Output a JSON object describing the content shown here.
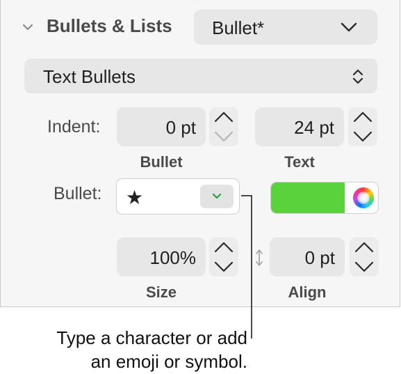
{
  "section": {
    "title": "Bullets & Lists",
    "style_popup": "Bullet*"
  },
  "bullet_type_popup": "Text Bullets",
  "indent": {
    "label": "Indent:",
    "bullet_value": "0 pt",
    "bullet_sublabel": "Bullet",
    "text_value": "24 pt",
    "text_sublabel": "Text"
  },
  "bullet_row": {
    "label": "Bullet:",
    "character": "★",
    "color": "#5ad23c"
  },
  "size_align": {
    "size_value": "100%",
    "size_sublabel": "Size",
    "align_value": "0 pt",
    "align_sublabel": "Align"
  },
  "callout": {
    "line1": "Type a character or add",
    "line2": "an emoji or symbol."
  },
  "icons": [
    "disclosure-chevron-icon",
    "chevron-down-icon",
    "updown-chevron-icon",
    "stepper-icon",
    "color-wheel-icon",
    "vertical-resize-icon"
  ]
}
